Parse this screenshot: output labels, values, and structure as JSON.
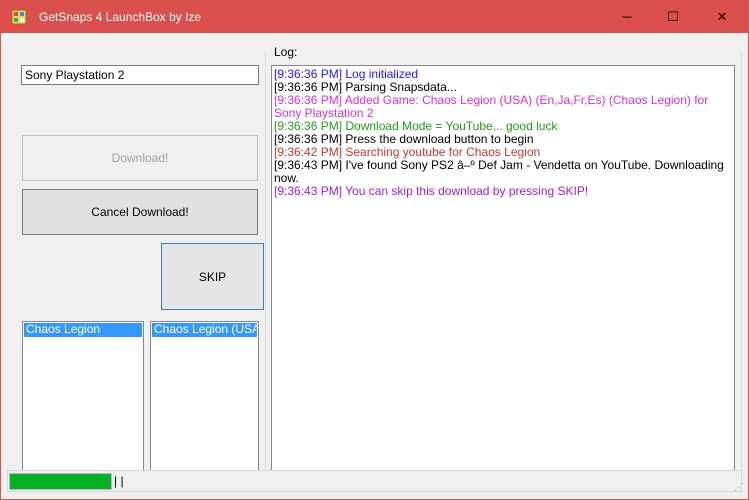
{
  "window": {
    "title": "GetSnaps 4 LaunchBox by Ize",
    "icon": "app-icon",
    "controls": {
      "minimize": "─",
      "maximize": "☐",
      "close": "✕"
    }
  },
  "system_input": {
    "value": "Sony Playstation 2"
  },
  "buttons": {
    "download": "Download!",
    "cancel": "Cancel Download!",
    "skip": "SKIP"
  },
  "games_list": {
    "items": [
      "Chaos Legion"
    ],
    "selected": 0
  },
  "results_list": {
    "items": [
      "Chaos Legion (USA) ("
    ],
    "selected": 0
  },
  "log": {
    "label": "Log:",
    "entries": [
      {
        "text": "[9:36:36 PM] Log initialized",
        "color": "#1a1aff"
      },
      {
        "text": "[9:36:36 PM] Parsing Snapsdata...",
        "color": "#000000"
      },
      {
        "text": "[9:36:36 PM] Added Game: Chaos Legion (USA) (En,Ja,Fr,Es) (Chaos Legion) for Sony Playstation 2",
        "color": "#d633c4"
      },
      {
        "text": "[9:36:36 PM] Download Mode = YouTube... good luck",
        "color": "#1f9a1f"
      },
      {
        "text": "[9:36:36 PM] Press the download button to begin",
        "color": "#000000"
      },
      {
        "text": "[9:36:42 PM] Searching youtube for Chaos Legion",
        "color": "#c0392b"
      },
      {
        "text": "[9:36:43 PM] I've found Sony PS2 â–º Def Jam - Vendetta on YouTube. Downloading now.",
        "color": "#000000"
      },
      {
        "text": "[9:36:43 PM] You can skip this download by pressing SKIP!",
        "color": "#9b1fd6"
      }
    ]
  },
  "status": {
    "progress_percent": 100,
    "text": "| |"
  },
  "colors": {
    "titlebar": "#dc4f4f",
    "progress": "#06b025",
    "selection": "#3399ff"
  }
}
